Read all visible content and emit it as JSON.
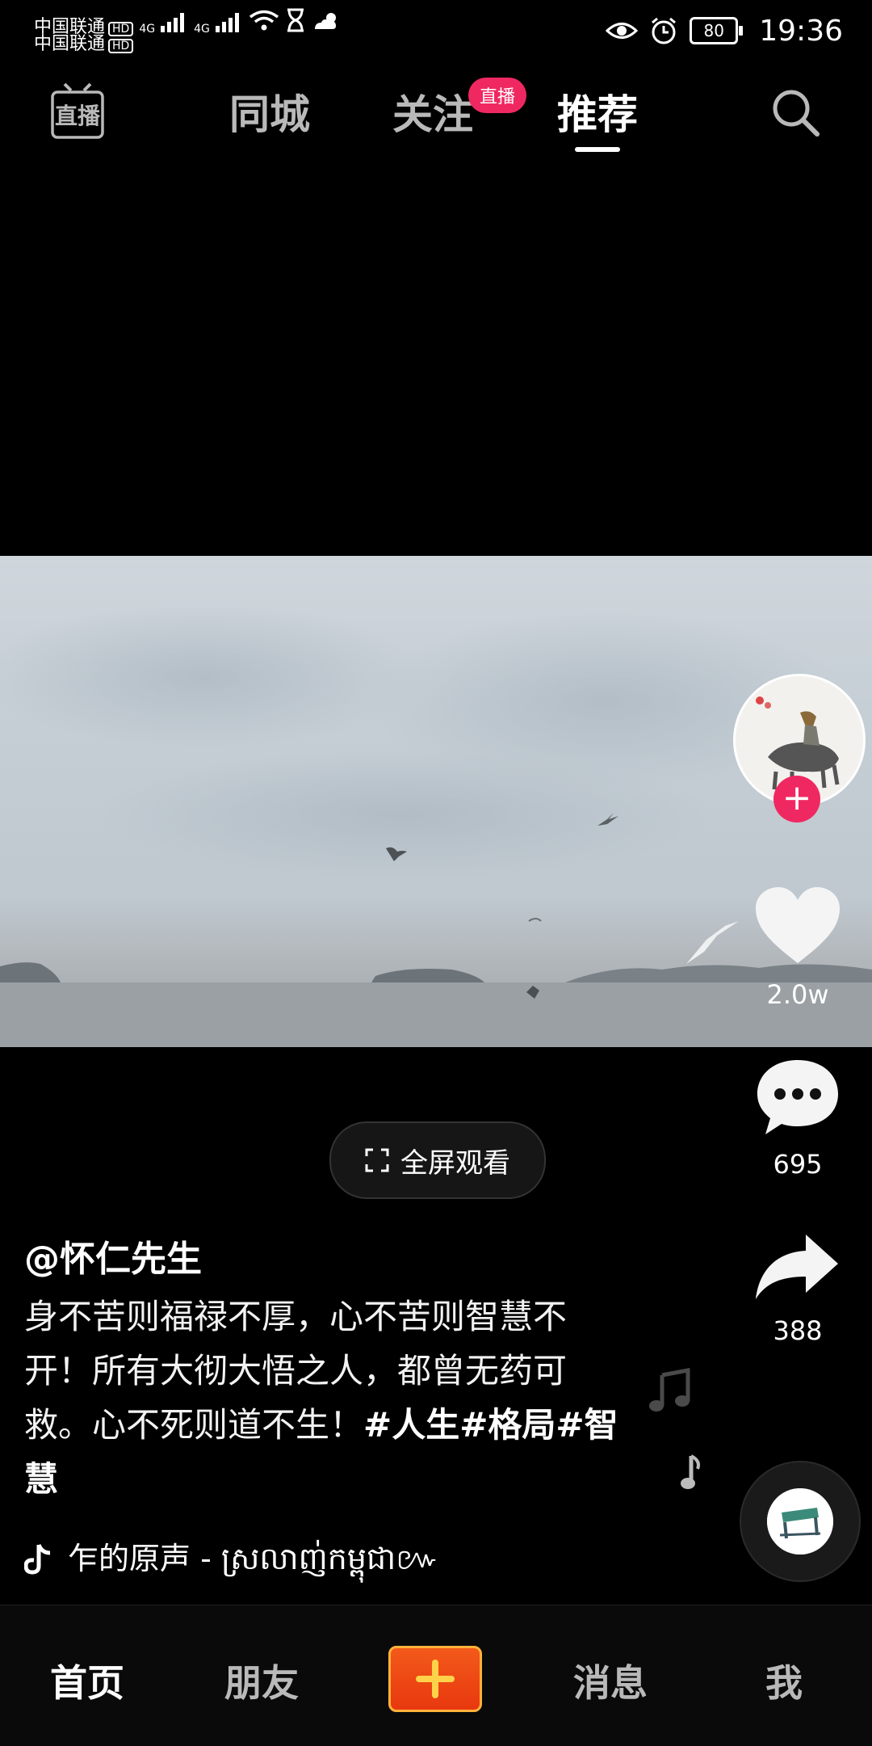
{
  "status_bar": {
    "carrier1": "中国联通",
    "carrier2": "中国联通",
    "hd": "HD",
    "net1": "4G",
    "net2": "4G",
    "battery": "80",
    "time": "19:36"
  },
  "top_nav": {
    "live_icon_label": "直播",
    "tabs": [
      {
        "label": "同城"
      },
      {
        "label": "关注"
      },
      {
        "label": "推荐"
      }
    ],
    "follow_badge": "直播",
    "active_tab": "推荐"
  },
  "right_rail": {
    "likes": "2.0w",
    "comments": "695",
    "shares": "388"
  },
  "fullscreen_label": "全屏观看",
  "post": {
    "author": "@怀仁先生",
    "description": "身不苦则福禄不厚，心不苦则智慧不开！所有大彻大悟之人，都曾无药可救。心不死则道不生！",
    "hashtags": "#人生#格局#智慧",
    "music": "乍的原声 - ស្រលាញ់កម្ពុជា៚"
  },
  "bottom_nav": {
    "items": [
      {
        "label": "首页"
      },
      {
        "label": "朋友"
      },
      {
        "label": "消息"
      },
      {
        "label": "我"
      }
    ],
    "active": "首页"
  },
  "colors": {
    "accent": "#f02861",
    "background": "#000000",
    "inactive_text": "#b9b9b9"
  }
}
